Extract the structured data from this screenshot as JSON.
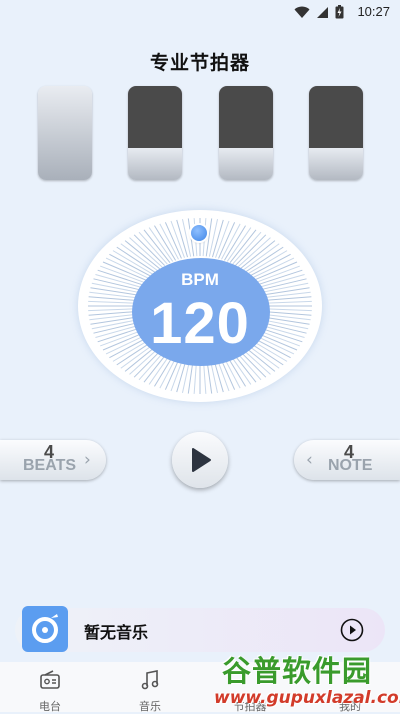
{
  "status_bar": {
    "time": "10:27"
  },
  "app": {
    "title": "专业节拍器"
  },
  "beats": [
    {
      "accent": true
    },
    {
      "accent": false
    },
    {
      "accent": false
    },
    {
      "accent": false
    }
  ],
  "tempo": {
    "label": "BPM",
    "value": "120"
  },
  "beats_control": {
    "value": "4",
    "label": "BEATS"
  },
  "note_control": {
    "value": "4",
    "label": "NOTE"
  },
  "player": {
    "song": "暂无音乐"
  },
  "tabs": [
    {
      "label": "电台",
      "icon": "radio-icon"
    },
    {
      "label": "音乐",
      "icon": "music-note-icon"
    },
    {
      "label": "节拍器",
      "icon": "metronome-icon"
    },
    {
      "label": "我的",
      "icon": "profile-icon"
    }
  ],
  "watermark": {
    "title": "谷普软件园",
    "url": "www.gupuxlazal.com"
  },
  "colors": {
    "accent": "#7aa8ec",
    "background": "#e9f1fb",
    "knob": "#3f85e6",
    "watermark_green": "#3a9b2c",
    "watermark_red": "#d23b2a"
  }
}
